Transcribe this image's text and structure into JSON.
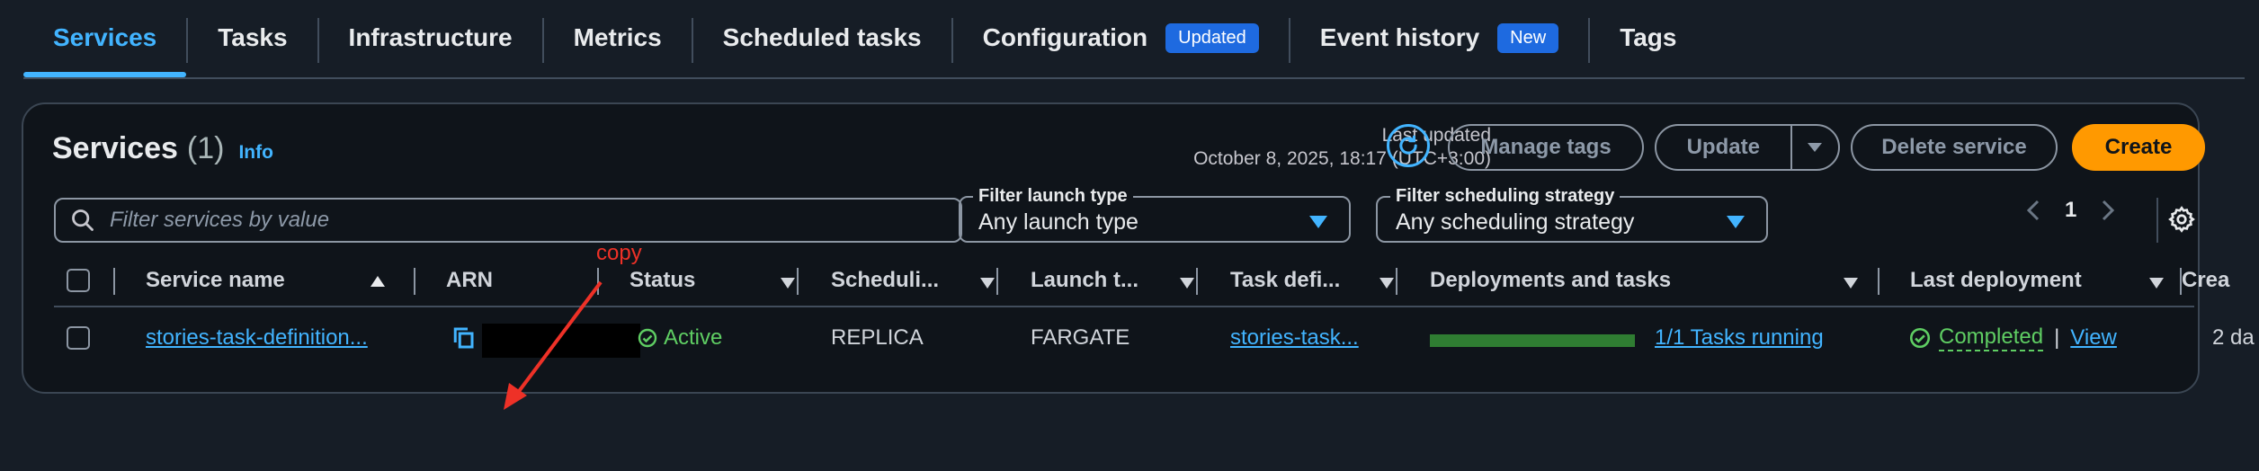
{
  "tabs": [
    {
      "label": "Services"
    },
    {
      "label": "Tasks"
    },
    {
      "label": "Infrastructure"
    },
    {
      "label": "Metrics"
    },
    {
      "label": "Scheduled tasks"
    },
    {
      "label": "Configuration",
      "badge": "Updated"
    },
    {
      "label": "Event history",
      "badge": "New"
    },
    {
      "label": "Tags"
    }
  ],
  "panel": {
    "title": "Services",
    "count": "(1)",
    "info": "Info",
    "last_updated_label": "Last updated",
    "last_updated_value": "October 8, 2025, 18:17 (UTC+3:00)",
    "buttons": {
      "manage_tags": "Manage tags",
      "update": "Update",
      "delete": "Delete service",
      "create": "Create"
    }
  },
  "filters": {
    "search_placeholder": "Filter services by value",
    "launch_type_label": "Filter launch type",
    "launch_type_value": "Any launch type",
    "strategy_label": "Filter scheduling strategy",
    "strategy_value": "Any scheduling strategy"
  },
  "pagination": {
    "page": "1"
  },
  "table": {
    "columns": {
      "service_name": "Service name",
      "arn": "ARN",
      "status": "Status",
      "scheduling": "Scheduli...",
      "launch": "Launch t...",
      "task_def": "Task defi...",
      "deployments": "Deployments and tasks",
      "last_deployment": "Last deployment",
      "created": "Crea"
    },
    "rows": [
      {
        "service_name": "stories-task-definition...",
        "status": "Active",
        "scheduling": "REPLICA",
        "launch": "FARGATE",
        "task_def": "stories-task...",
        "tasks_progress": 1.0,
        "tasks_text": "1/1 Tasks running",
        "last_deployment": "Completed",
        "view": "View",
        "created": "2 da"
      }
    ]
  },
  "annotation": {
    "text": "copy",
    "color": "#ee3127"
  },
  "colors": {
    "accent": "#42b4ff",
    "success": "#5fce63",
    "primary_button": "#ff9900",
    "progress": "#2f7d32"
  }
}
